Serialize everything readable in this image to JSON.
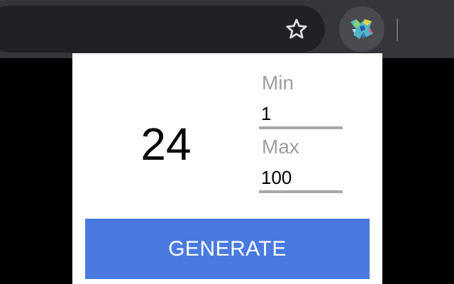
{
  "browser": {
    "icons": {
      "bookmark": "star-outline-icon",
      "extension": "extension-colorful-logo-icon"
    }
  },
  "popup": {
    "result": "24",
    "min": {
      "label": "Min",
      "value": "1"
    },
    "max": {
      "label": "Max",
      "value": "100"
    },
    "generate_label": "GENERATE",
    "colors": {
      "button": "#4a7ae0",
      "label": "#9e9e9e",
      "underline": "#a8a8a8"
    }
  }
}
